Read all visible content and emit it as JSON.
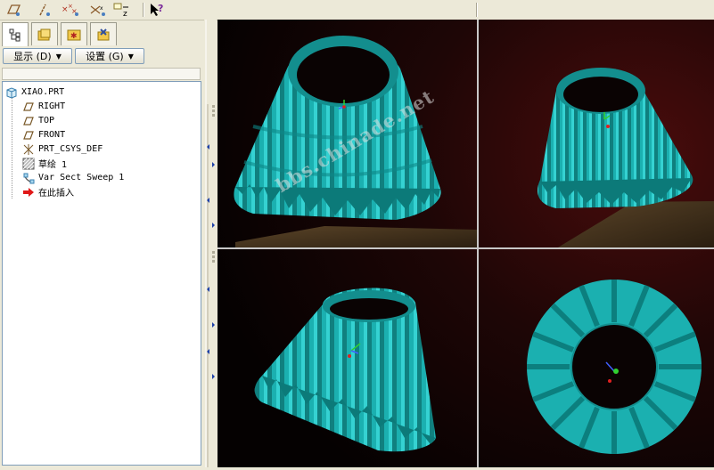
{
  "toolbar": {
    "icons": [
      "datum-plane-icon",
      "datum-axis-icon",
      "datum-point-icon",
      "coordinate-system-icon",
      "analysis-icon",
      "context-help-icon"
    ]
  },
  "tabs": [
    {
      "name": "model-tree-tab",
      "icon": "model-tree-icon",
      "active": true
    },
    {
      "name": "folder-browser-tab",
      "icon": "folder-icon",
      "active": false
    },
    {
      "name": "favorites-tab",
      "icon": "favorites-icon",
      "active": false
    },
    {
      "name": "connections-tab",
      "icon": "connections-icon",
      "active": false
    }
  ],
  "buttons": {
    "display_label": "显示 (D)",
    "settings_label": "设置 (G)"
  },
  "model_tree": {
    "root": "XIAO.PRT",
    "items": [
      {
        "label": "RIGHT",
        "icon": "datum-plane-icon"
      },
      {
        "label": "TOP",
        "icon": "datum-plane-icon"
      },
      {
        "label": "FRONT",
        "icon": "datum-plane-icon"
      },
      {
        "label": "PRT_CSYS_DEF",
        "icon": "coordinate-system-icon"
      },
      {
        "label": "草绘 1",
        "icon": "sketch-icon"
      },
      {
        "label": "Var Sect Sweep 1",
        "icon": "sweep-icon"
      },
      {
        "label": "在此插入",
        "icon": "insert-here-arrow-icon"
      }
    ]
  },
  "viewport": {
    "watermark": "bbs.chinade.net",
    "model_color": "#1fb3b3",
    "views": [
      "view-top-left",
      "view-top-right",
      "view-bottom-left",
      "view-bottom-right"
    ]
  }
}
